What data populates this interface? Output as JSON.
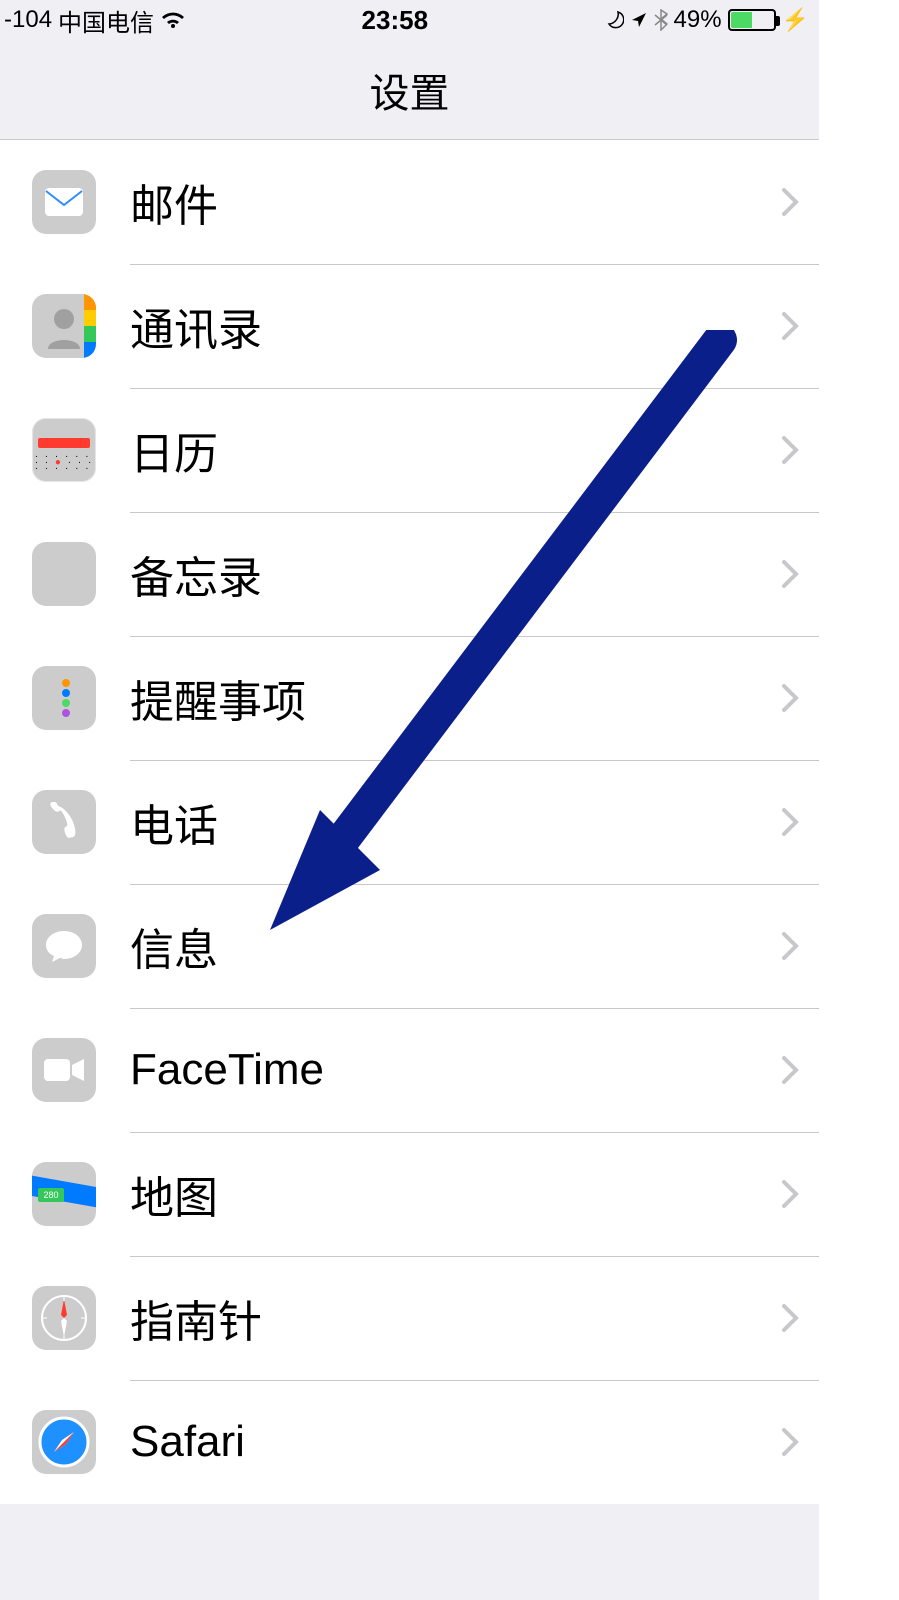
{
  "status": {
    "signal": "-104",
    "carrier": "中国电信",
    "time": "23:58",
    "battery_pct": "49%",
    "battery_fill": 49
  },
  "nav": {
    "title": "设置"
  },
  "rows": {
    "mail": "邮件",
    "contacts": "通讯录",
    "calendar": "日历",
    "notes": "备忘录",
    "reminders": "提醒事项",
    "phone": "电话",
    "messages": "信息",
    "facetime": "FaceTime",
    "maps": "地图",
    "compass": "指南针",
    "safari": "Safari"
  },
  "annotation": {
    "arrow_color": "#0b1f8a"
  }
}
